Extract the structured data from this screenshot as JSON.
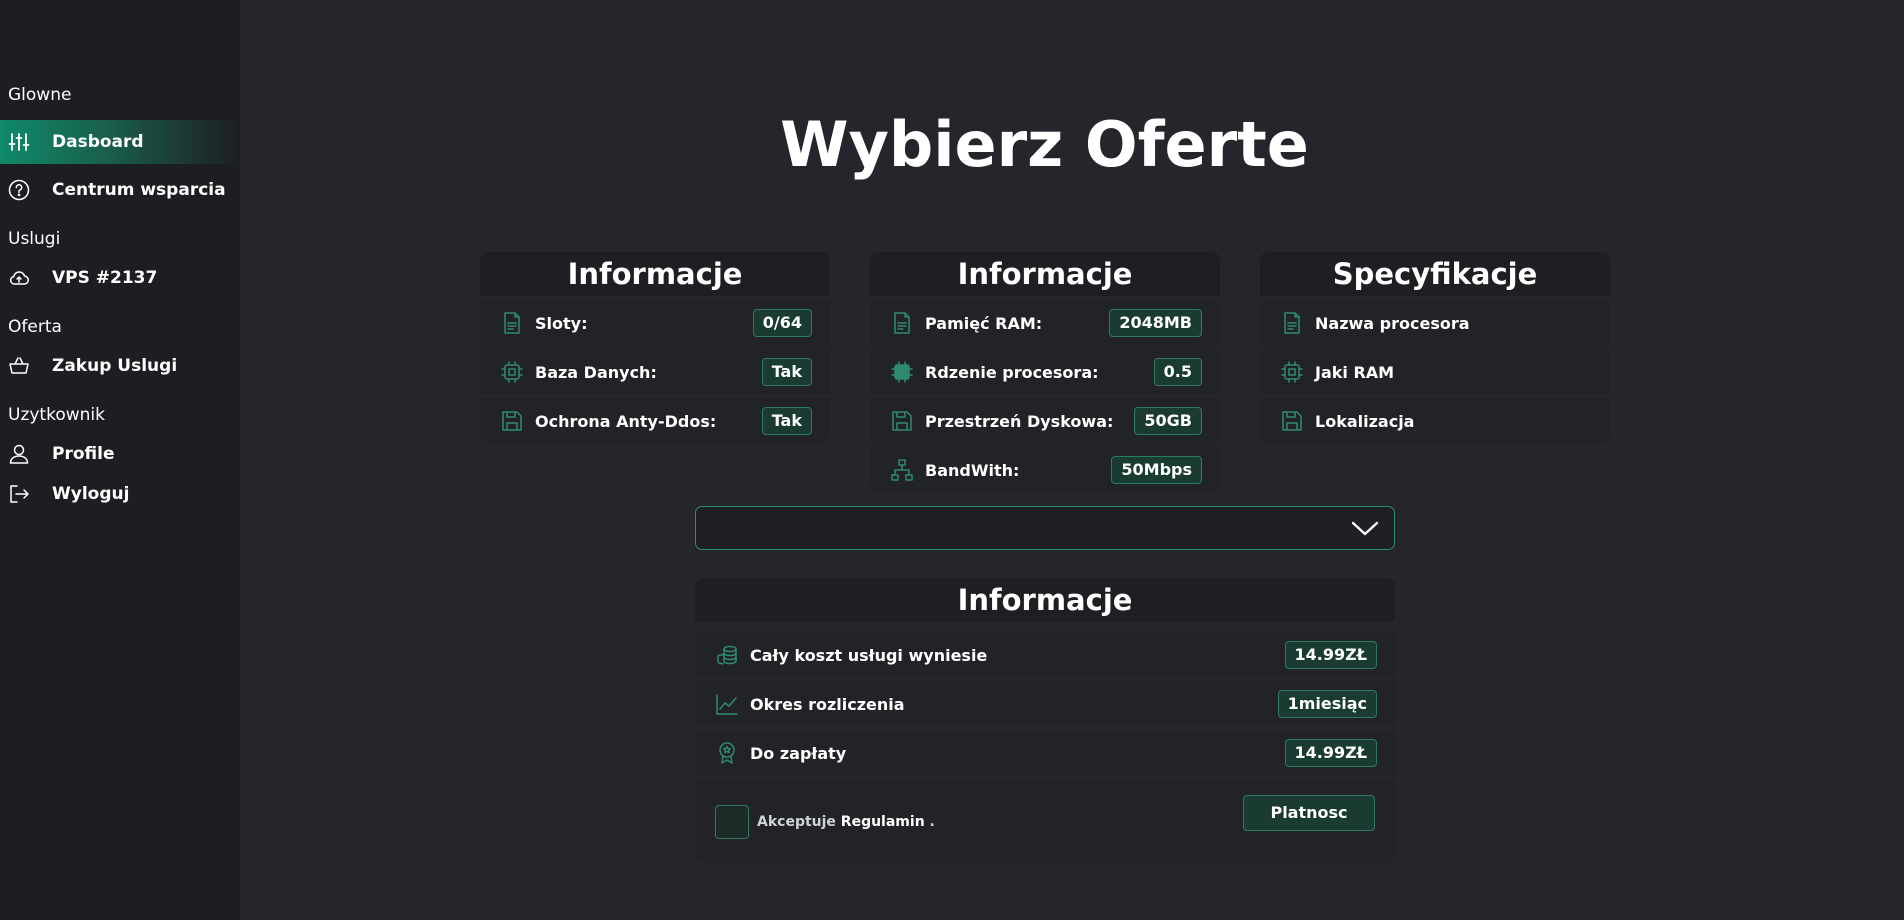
{
  "sidebar": {
    "sections": [
      {
        "title": "Glowne"
      },
      {
        "title": "Uslugi"
      },
      {
        "title": "Oferta"
      },
      {
        "title": "Uzytkownik"
      }
    ],
    "items": [
      {
        "label": "Dasboard",
        "icon": "sliders-icon"
      },
      {
        "label": "Centrum wsparcia",
        "icon": "help-icon"
      },
      {
        "label": "VPS #2137",
        "icon": "cloud-icon"
      },
      {
        "label": "Zakup Uslugi",
        "icon": "basket-icon"
      },
      {
        "label": "Profile",
        "icon": "user-icon"
      },
      {
        "label": "Wyloguj",
        "icon": "logout-icon"
      }
    ]
  },
  "page": {
    "title": "Wybierz Oferte"
  },
  "cards": [
    {
      "title": "Informacje",
      "rows": [
        {
          "label": "Sloty:",
          "value": "0/64",
          "icon": "document-icon"
        },
        {
          "label": "Baza Danych:",
          "value": "Tak",
          "icon": "cpu-icon"
        },
        {
          "label": "Ochrona Anty-Ddos:",
          "value": "Tak",
          "icon": "floppy-icon"
        }
      ]
    },
    {
      "title": "Informacje",
      "rows": [
        {
          "label": "Pamięć RAM:",
          "value": "2048MB",
          "icon": "document-icon"
        },
        {
          "label": "Rdzenie procesora:",
          "value": "0.5",
          "icon": "cpu-filled-icon"
        },
        {
          "label": "Przestrzeń Dyskowa:",
          "value": "50GB",
          "icon": "floppy-icon"
        },
        {
          "label": "BandWith:",
          "value": "50Mbps",
          "icon": "network-icon"
        }
      ]
    },
    {
      "title": "Specyfikacje",
      "rows": [
        {
          "label": "Nazwa procesora",
          "icon": "document-icon"
        },
        {
          "label": "Jaki RAM",
          "icon": "cpu-icon"
        },
        {
          "label": "Lokalizacja",
          "icon": "floppy-icon"
        }
      ]
    }
  ],
  "dropdown": {
    "value": "",
    "icon": "chevron-down-icon"
  },
  "summary": {
    "title": "Informacje",
    "rows": [
      {
        "label": "Cały koszt usługi wyniesie",
        "value": "14.99ZŁ",
        "icon": "coins-icon"
      },
      {
        "label": "Okres rozliczenia",
        "value": "1miesiąc",
        "icon": "chart-line-icon"
      },
      {
        "label": "Do zapłaty",
        "value": "14.99ZŁ",
        "icon": "award-icon"
      }
    ],
    "accept_text": "Akceptuje",
    "accept_link": "Regulamin",
    "accept_suffix": ".",
    "pay_button": "Platnosc"
  },
  "colors": {
    "accent": "#2e8b70",
    "badge_bg": "#1a3b32",
    "bg": "#25262b",
    "sidebar": "#1d1e22"
  }
}
